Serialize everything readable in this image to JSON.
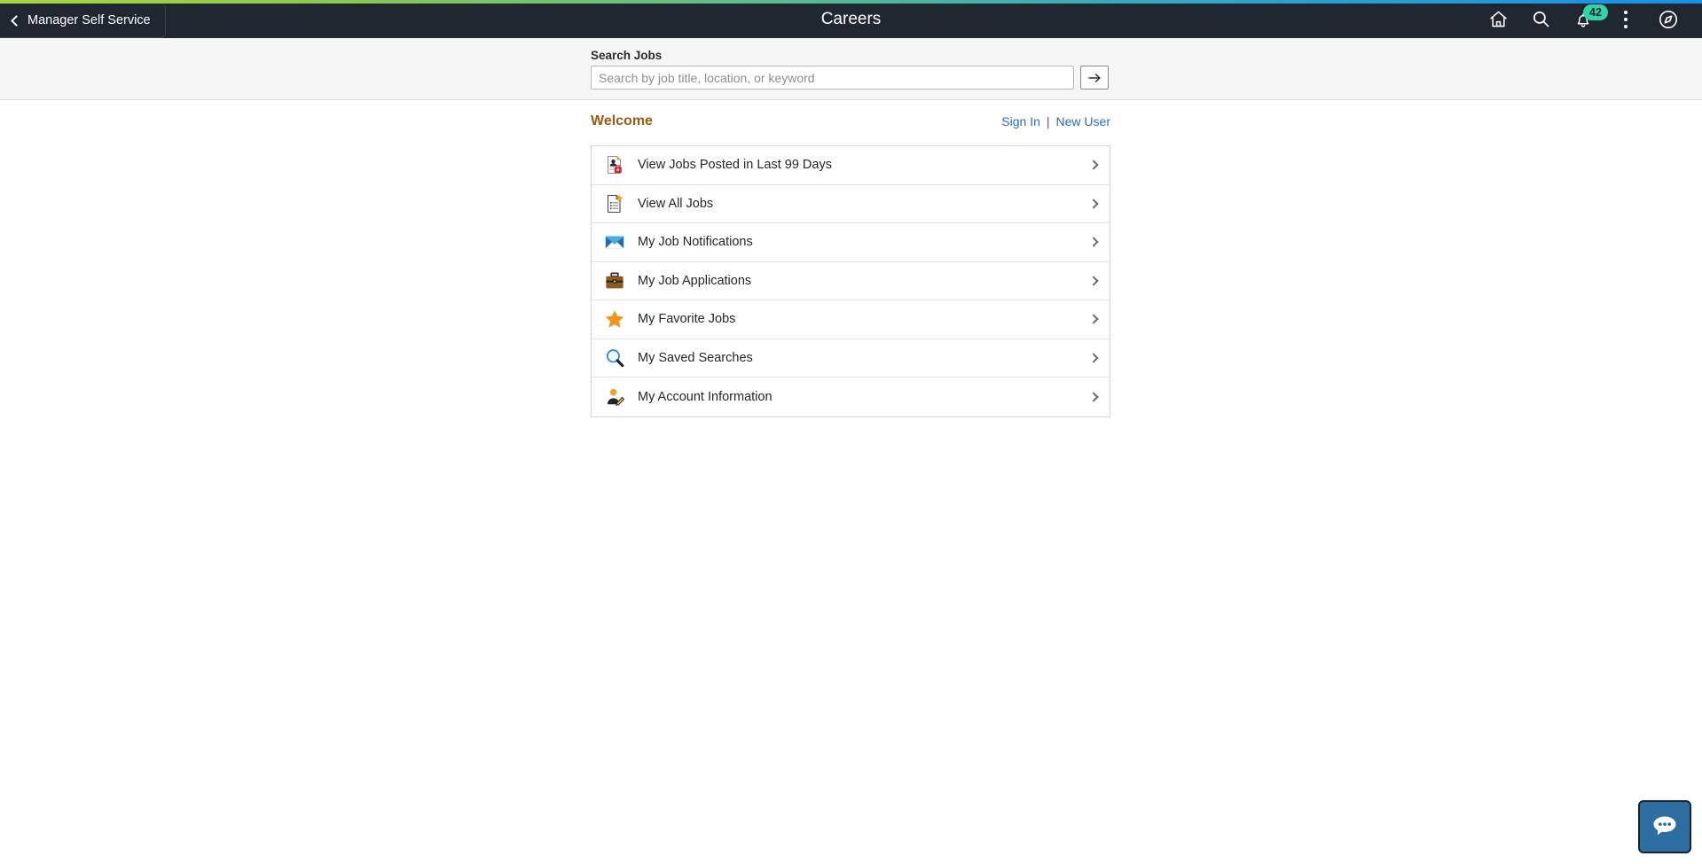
{
  "header": {
    "back_label": "Manager Self Service",
    "title": "Careers",
    "icons": [
      {
        "name": "home-icon",
        "label": "Home"
      },
      {
        "name": "search-icon",
        "label": "Search"
      },
      {
        "name": "notifications-icon",
        "label": "Notifications"
      },
      {
        "name": "actions-menu-icon",
        "label": "Actions"
      },
      {
        "name": "navigator-icon",
        "label": "Navigator"
      }
    ],
    "notification_count": "42",
    "notification_badge_color": "#2ed3a7",
    "background_color": "#212731",
    "accent_gradient_start": "#a6d544",
    "accent_gradient_end": "#1a8fe3"
  },
  "search": {
    "label": "Search Jobs",
    "placeholder": "Search by job title, location, or keyword",
    "value": "",
    "submit_icon": "arrow-right-icon"
  },
  "welcome": {
    "title": "Welcome",
    "title_color": "#9c5a12",
    "sign_in_label": "Sign In",
    "separator": "|",
    "new_user_label": "New User",
    "link_color": "#2b6cb8"
  },
  "tiles": [
    {
      "label": "View Jobs Posted in Last 99 Days",
      "icon": "job-posting-person-icon"
    },
    {
      "label": "View All Jobs",
      "icon": "document-star-icon"
    },
    {
      "label": "My Job Notifications",
      "icon": "envelope-icon"
    },
    {
      "label": "My Job Applications",
      "icon": "briefcase-icon"
    },
    {
      "label": "My Favorite Jobs",
      "icon": "star-icon"
    },
    {
      "label": "My Saved Searches",
      "icon": "magnifier-icon"
    },
    {
      "label": "My Account Information",
      "icon": "person-edit-icon"
    }
  ],
  "chat": {
    "icon": "chat-bubble-icon",
    "label": "Chat",
    "background_color": "#2e6ea2"
  }
}
